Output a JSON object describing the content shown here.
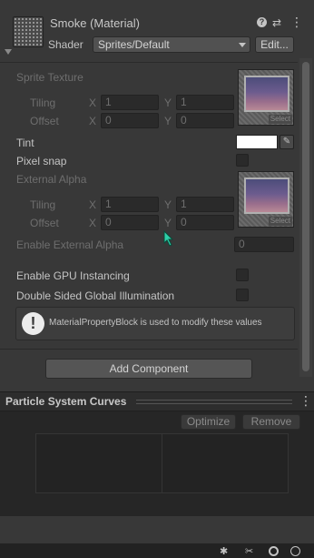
{
  "header": {
    "title": "Smoke (Material)",
    "shader_label": "Shader",
    "shader_value": "Sprites/Default",
    "edit_label": "Edit...",
    "help_icon": "help-icon",
    "settings_icon": "sliders-icon",
    "menu_icon": "kebab-menu-icon"
  },
  "sprite_texture": {
    "label": "Sprite Texture",
    "tiling_label": "Tiling",
    "offset_label": "Offset",
    "x_label": "X",
    "y_label": "Y",
    "tiling_x": "1",
    "tiling_y": "1",
    "offset_x": "0",
    "offset_y": "0",
    "select_label": "Select"
  },
  "tint": {
    "label": "Tint",
    "color": "#ffffff"
  },
  "pixel_snap": {
    "label": "Pixel snap"
  },
  "external_alpha": {
    "label": "External Alpha",
    "tiling_label": "Tiling",
    "offset_label": "Offset",
    "x_label": "X",
    "y_label": "Y",
    "tiling_x": "1",
    "tiling_y": "1",
    "offset_x": "0",
    "offset_y": "0",
    "select_label": "Select"
  },
  "enable_external_alpha": {
    "label": "Enable External Alpha",
    "value": "0"
  },
  "gpu_instancing": {
    "label": "Enable GPU Instancing"
  },
  "double_sided_gi": {
    "label": "Double Sided Global Illumination"
  },
  "info_box": {
    "text": "MaterialPropertyBlock is used to modify these values"
  },
  "add_component": {
    "label": "Add Component"
  },
  "curves_panel": {
    "title": "Particle System Curves",
    "optimize_label": "Optimize",
    "remove_label": "Remove"
  }
}
